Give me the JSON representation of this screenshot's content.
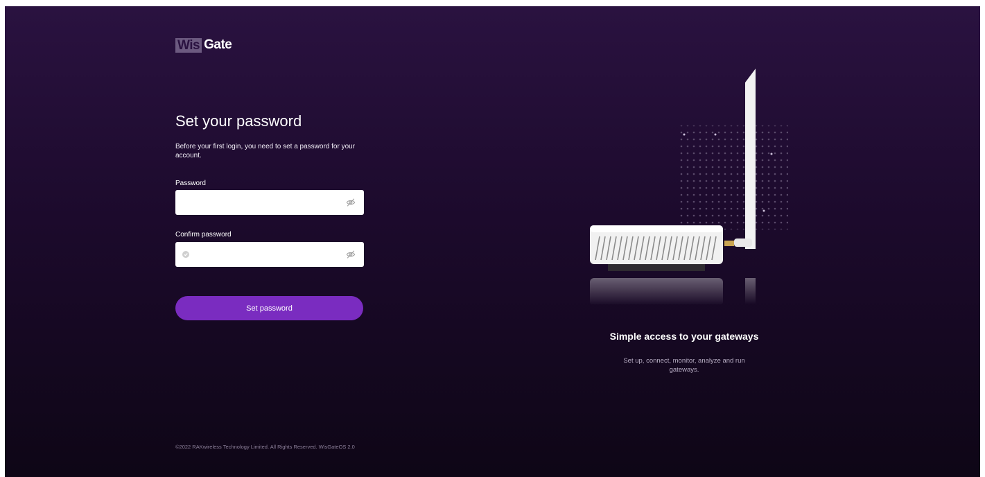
{
  "brand": {
    "logo_part1": "Wis",
    "logo_part2": "Gate"
  },
  "form": {
    "title": "Set your password",
    "description": "Before your first login, you need to set a password for your account.",
    "password_label": "Password",
    "password_value": "",
    "confirm_label": "Confirm password",
    "confirm_value": "",
    "submit_label": "Set password"
  },
  "promo": {
    "title": "Simple access to your gateways",
    "text": "Set up, connect, monitor, analyze and run gateways."
  },
  "footer": {
    "copyright": "©2022 RAKwireless Technology Limited. All Rights Reserved. WisGateOS 2.0"
  },
  "icons": {
    "password_visibility": "eye-off-icon",
    "confirm_status": "check-circle-icon",
    "confirm_visibility": "eye-off-icon"
  },
  "colors": {
    "background_top": "#2a1240",
    "background_bottom": "#0e0616",
    "accent": "#7a2cc0"
  }
}
